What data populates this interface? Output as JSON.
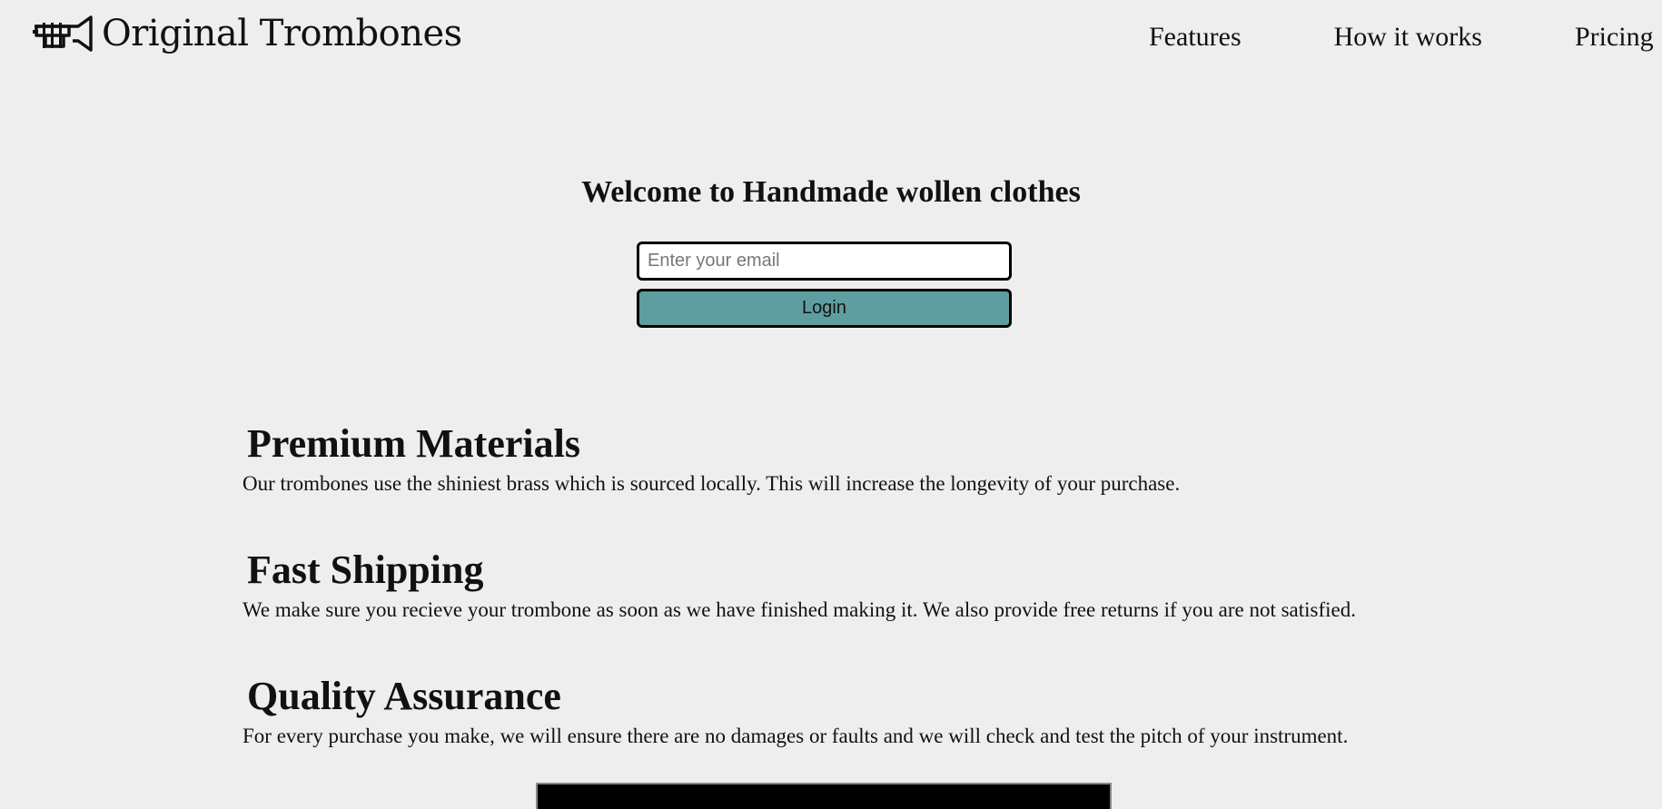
{
  "header": {
    "logo_text": "Original Trombones",
    "logo_icon": "trombone-icon",
    "nav": [
      {
        "label": "Features"
      },
      {
        "label": "How it works"
      },
      {
        "label": "Pricing"
      }
    ]
  },
  "hero": {
    "title": "Welcome to Handmade wollen clothes",
    "email_placeholder": "Enter your email",
    "email_value": "",
    "login_label": "Login"
  },
  "features": [
    {
      "title": "Premium Materials",
      "text": "Our trombones use the shiniest brass which is sourced locally. This will increase the longevity of your purchase."
    },
    {
      "title": "Fast Shipping",
      "text": "We make sure you recieve your trombone as soon as we have finished making it. We also provide free returns if you are not satisfied."
    },
    {
      "title": "Quality Assurance",
      "text": "For every purchase you make, we will ensure there are no damages or faults and we will check and test the pitch of your instrument."
    }
  ],
  "colors": {
    "background": "#eeeeee",
    "button": "#5f9ea0",
    "text": "#111111"
  }
}
